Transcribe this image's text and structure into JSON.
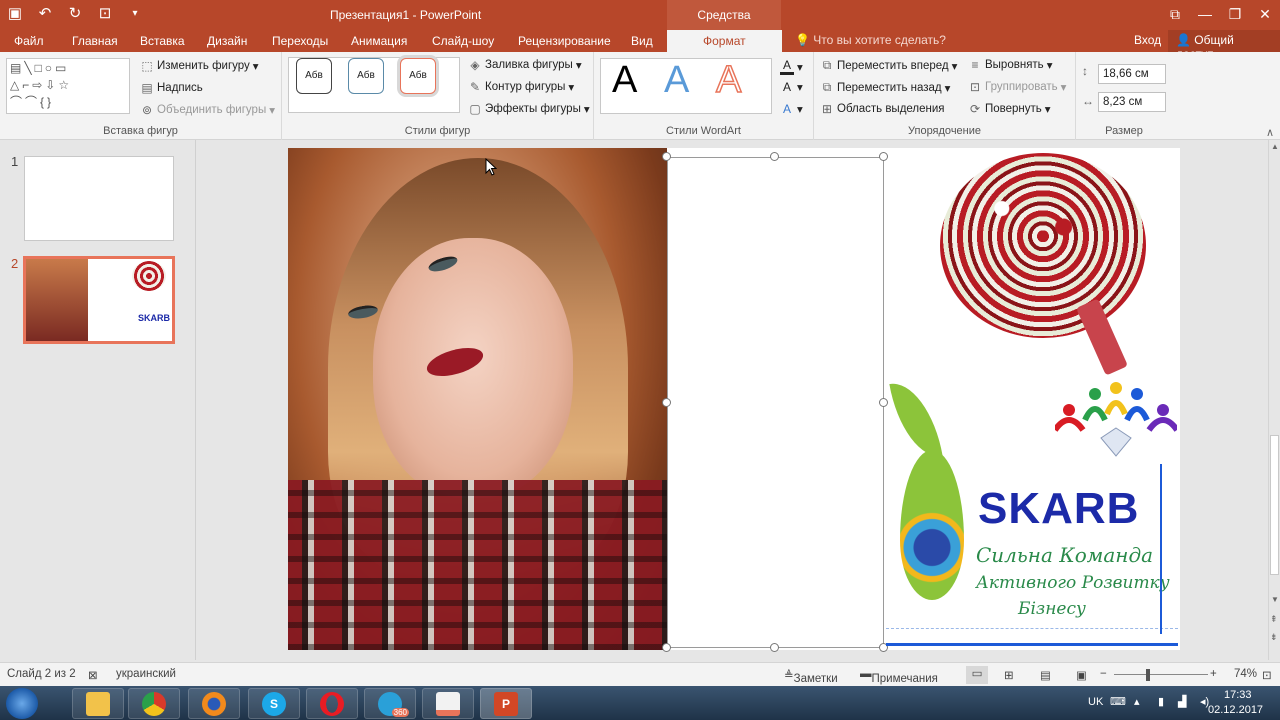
{
  "titlebar": {
    "title": "Презентация1 - PowerPoint",
    "context_tab": "Средства рисования"
  },
  "tabs": {
    "items": [
      "Файл",
      "Главная",
      "Вставка",
      "Дизайн",
      "Переходы",
      "Анимация",
      "Слайд-шоу",
      "Рецензирование",
      "Вид"
    ],
    "active": "Формат",
    "tell_me": "Что вы хотите сделать?",
    "sign_in": "Вход",
    "share": "Общий доступ"
  },
  "ribbon": {
    "insert_shapes": {
      "edit_shape": "Изменить фигуру",
      "text_box": "Надпись",
      "merge_shapes": "Объединить фигуры",
      "label": "Вставка фигур"
    },
    "shape_styles": {
      "style_sample": "Абв",
      "fill": "Заливка фигуры",
      "outline": "Контур фигуры",
      "effects": "Эффекты фигуры",
      "label": "Стили фигур"
    },
    "wordart": {
      "letter": "A",
      "label": "Стили WordArt"
    },
    "arrange": {
      "bring_forward": "Переместить вперед",
      "send_backward": "Переместить назад",
      "selection_pane": "Область выделения",
      "align": "Выровнять",
      "group": "Группировать",
      "rotate": "Повернуть",
      "label": "Упорядочение"
    },
    "size": {
      "height": "18,66 см",
      "width": "8,23 см",
      "label": "Размер"
    }
  },
  "slides": {
    "numbers": [
      "1",
      "2"
    ],
    "selected": 2
  },
  "slide": {
    "brand": "SKARB",
    "slogan_line1": "Сильна Команда",
    "slogan_line2": "Активного Розвитку",
    "slogan_line3": "Бізнесу"
  },
  "status": {
    "slide_counter": "Слайд 2 из 2",
    "language": "украинский",
    "notes": "Заметки",
    "comments": "Примечания",
    "zoom": "74%"
  },
  "tray": {
    "lang": "UK",
    "time": "17:33",
    "date": "02.12.2017",
    "telegram_badge": "360"
  },
  "colors": {
    "brand": "#b7472a",
    "accent": "#e8745a"
  }
}
